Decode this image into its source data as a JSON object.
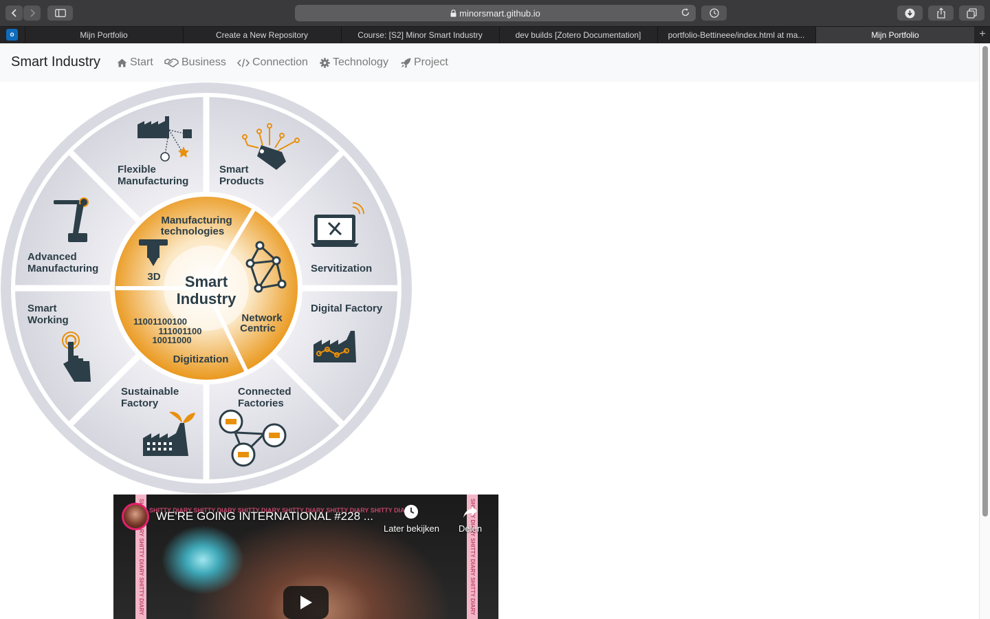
{
  "browser": {
    "url": "minorsmart.github.io",
    "tabs": [
      {
        "title": "Mijn Portfolio",
        "active": false
      },
      {
        "title": "Create a New Repository",
        "active": false
      },
      {
        "title": "Course: [S2] Minor Smart Industry",
        "active": false
      },
      {
        "title": "dev builds [Zotero Documentation]",
        "active": false
      },
      {
        "title": "portfolio-Bettineee/index.html at ma...",
        "active": false
      },
      {
        "title": "Mijn Portfolio",
        "active": true
      }
    ],
    "pinned_tab_icon": "outlook-icon",
    "pinned_tab_letter": "o",
    "new_tab_symbol": "+"
  },
  "navbar": {
    "brand": "Smart Industry",
    "items": [
      {
        "label": "Start",
        "icon": "home-icon"
      },
      {
        "label": "Business",
        "icon": "handshake-icon"
      },
      {
        "label": "Connection",
        "icon": "code-icon"
      },
      {
        "label": "Technology",
        "icon": "gear-icon"
      },
      {
        "label": "Project",
        "icon": "rocket-icon"
      }
    ]
  },
  "wheel": {
    "center_title_line1": "Smart",
    "center_title_line2": "Industry",
    "inner": [
      {
        "line1": "Manufacturing",
        "line2": "technologies",
        "extra": "3D"
      },
      {
        "line1": "Network",
        "line2": "Centric"
      },
      {
        "line1": "Digitization",
        "binary1": "11001100100",
        "binary2": "111001100",
        "binary3": "10011000"
      }
    ],
    "outer": [
      {
        "line1": "Flexible",
        "line2": "Manufacturing"
      },
      {
        "line1": "Smart",
        "line2": "Products"
      },
      {
        "line1": "Servitization",
        "line2": ""
      },
      {
        "line1": "Digital Factory",
        "line2": ""
      },
      {
        "line1": "Connected",
        "line2": "Factories"
      },
      {
        "line1": "Sustainable",
        "line2": "Factory"
      },
      {
        "line1": "Smart",
        "line2": "Working"
      },
      {
        "line1": "Advanced",
        "line2": "Manufacturing"
      }
    ],
    "colors": {
      "orange": "#e8900c",
      "dark": "#2c3e47",
      "ring": "#dcdce4"
    }
  },
  "video": {
    "title": "WE'RE GOING INTERNATIONAL #228 ...",
    "band_text": "SHITTY DIARY SHITTY DIARY SHITTY DIARY SHITTY DIARY SHITTY DIARY SHITTY DIARY",
    "watch_later": "Later bekijken",
    "share": "Delen"
  }
}
